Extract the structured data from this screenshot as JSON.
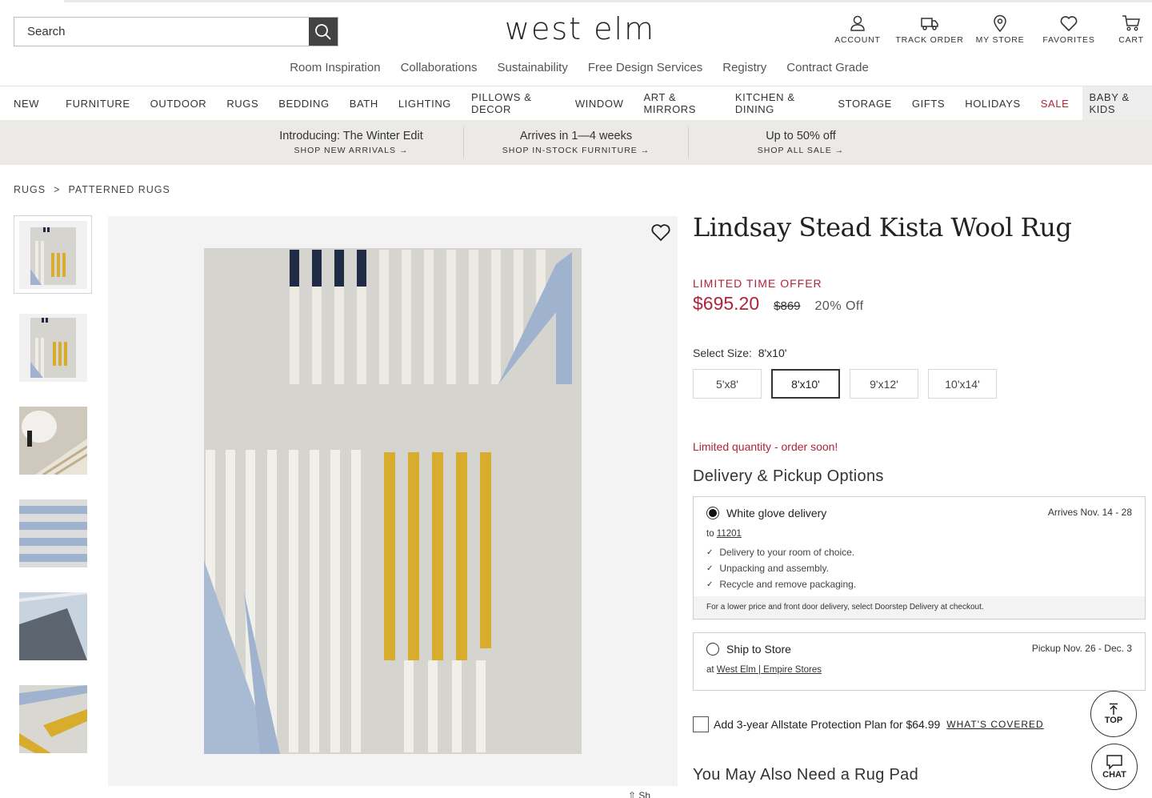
{
  "header": {
    "search_placeholder": "Search",
    "logo": "west elm",
    "utilities": [
      {
        "label": "ACCOUNT",
        "icon": "person-icon"
      },
      {
        "label": "TRACK ORDER",
        "icon": "truck-icon"
      },
      {
        "label": "MY STORE",
        "icon": "location-pin-icon"
      },
      {
        "label": "FAVORITES",
        "icon": "heart-icon"
      },
      {
        "label": "CART",
        "icon": "cart-icon"
      }
    ]
  },
  "secondary_nav": [
    "Room Inspiration",
    "Collaborations",
    "Sustainability",
    "Free Design Services",
    "Registry",
    "Contract Grade"
  ],
  "category_nav": [
    "NEW",
    "FURNITURE",
    "OUTDOOR",
    "RUGS",
    "BEDDING",
    "BATH",
    "LIGHTING",
    "PILLOWS & DECOR",
    "WINDOW",
    "ART & MIRRORS",
    "KITCHEN & DINING",
    "STORAGE",
    "GIFTS",
    "HOLIDAYS",
    "SALE",
    "BABY & KIDS"
  ],
  "promos": [
    {
      "title": "Introducing: The Winter Edit",
      "link": "SHOP NEW ARRIVALS →"
    },
    {
      "title": "Arrives in 1—4 weeks",
      "link": "SHOP IN-STOCK FURNITURE →"
    },
    {
      "title": "Up to 50% off",
      "link": "SHOP ALL SALE →"
    }
  ],
  "breadcrumb": [
    "RUGS",
    ">",
    "PATTERNED RUGS"
  ],
  "product": {
    "title": "Lindsay Stead Kista Wool Rug",
    "offer_label": "LIMITED TIME OFFER",
    "sale_price": "$695.20",
    "original_price": "$869",
    "discount": "20% Off",
    "size_label": "Select Size:",
    "selected_size": "8'x10'",
    "sizes": [
      "5'x8'",
      "8'x10'",
      "9'x12'",
      "10'x14'"
    ],
    "stock_note": "Limited quantity - order soon!"
  },
  "delivery": {
    "heading": "Delivery & Pickup Options",
    "white_glove": {
      "name": "White glove delivery",
      "date": "Arrives Nov. 14 - 28",
      "to_prefix": "to",
      "zip": "11201",
      "features": [
        "Delivery to your room of choice.",
        "Unpacking and assembly.",
        "Recycle and remove packaging."
      ],
      "note": "For a lower price and front door delivery, select Doorstep Delivery at checkout."
    },
    "ship_to_store": {
      "name": "Ship to Store",
      "date": "Pickup Nov. 26 - Dec. 3",
      "at_prefix": "at",
      "store": "West Elm | Empire Stores"
    }
  },
  "protection": {
    "label": "Add 3-year Allstate Protection Plan for $64.99",
    "link": "WHAT'S COVERED"
  },
  "also_need": "You May Also Need a Rug Pad",
  "floating": {
    "top": "TOP",
    "chat": "CHAT"
  },
  "share_label": "Sh",
  "colors": {
    "sale_red": "#b0233a",
    "promo_bg": "#eceae6",
    "rug_yellow": "#d8ac2c",
    "rug_blue": "#9fb3cf",
    "rug_navy": "#1f2a44"
  }
}
